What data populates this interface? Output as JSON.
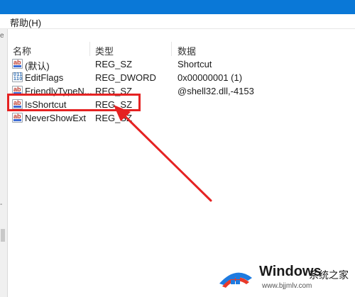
{
  "menubar": {
    "help_label": "帮助(H)"
  },
  "left_strip": {
    "top_char": "e",
    "mid_char": "-"
  },
  "columns": {
    "name": "名称",
    "type": "类型",
    "data": "数据"
  },
  "rows": [
    {
      "name": "(默认)",
      "type": "REG_SZ",
      "data": "Shortcut",
      "icon": "ab-string-icon"
    },
    {
      "name": "EditFlags",
      "type": "REG_DWORD",
      "data": "0x00000001 (1)",
      "icon": "binary-value-icon"
    },
    {
      "name": "FriendlyTypeN...",
      "type": "REG_SZ",
      "data": "@shell32.dll,-4153",
      "icon": "ab-string-icon"
    },
    {
      "name": "IsShortcut",
      "type": "REG_SZ",
      "data": "",
      "icon": "ab-string-icon"
    },
    {
      "name": "NeverShowExt",
      "type": "REG_SZ",
      "data": "",
      "icon": "ab-string-icon"
    }
  ],
  "annotation": {
    "highlight_color": "#e52222",
    "arrow_color": "#e52222"
  },
  "watermark": {
    "title": "Windows",
    "cn": "系统之家",
    "url": "www.bjjmlv.com"
  },
  "colors": {
    "titlebar": "#0a78d7",
    "logo_blue": "#1e7be0",
    "logo_red": "#e83a2a"
  }
}
